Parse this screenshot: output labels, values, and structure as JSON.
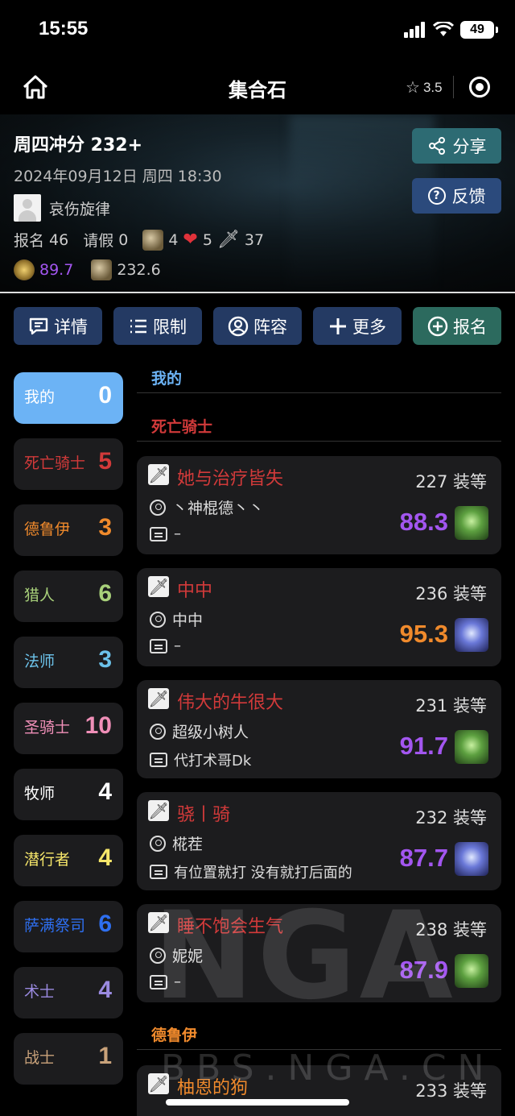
{
  "status_bar": {
    "time": "15:55",
    "battery": "49"
  },
  "nav": {
    "title": "集合石",
    "rating": "3.5"
  },
  "raid": {
    "title": "周四冲分 232+",
    "date": "2024年09月12日 周四 18:30",
    "leader": "哀伤旋律",
    "signup_label": "报名",
    "signup_count": "46",
    "leave_label": "请假",
    "leave_count": "0",
    "tank_count": "4",
    "heal_count": "5",
    "dps_count": "37",
    "score": "89.7",
    "ilvl": "232.6"
  },
  "side_buttons": {
    "share": "分享",
    "feedback": "反馈"
  },
  "actions": [
    {
      "label": "详情",
      "icon": "comment-icon"
    },
    {
      "label": "限制",
      "icon": "list-icon"
    },
    {
      "label": "阵容",
      "icon": "user-circle-icon"
    },
    {
      "label": "更多",
      "icon": "plus-icon"
    },
    {
      "label": "报名",
      "icon": "plus-circle-icon"
    }
  ],
  "classes": [
    {
      "name": "我的",
      "count": "0",
      "color": "#ffffff"
    },
    {
      "name": "死亡骑士",
      "count": "5",
      "color": "#d23a3a"
    },
    {
      "name": "德鲁伊",
      "count": "3",
      "color": "#f08a2c"
    },
    {
      "name": "猎人",
      "count": "6",
      "color": "#a8d07a"
    },
    {
      "name": "法师",
      "count": "3",
      "color": "#6cc2ea"
    },
    {
      "name": "圣骑士",
      "count": "10",
      "color": "#f08fb8"
    },
    {
      "name": "牧师",
      "count": "4",
      "color": "#ffffff"
    },
    {
      "name": "潜行者",
      "count": "4",
      "color": "#f6e66a"
    },
    {
      "name": "萨满祭司",
      "count": "6",
      "color": "#2e6ff0"
    },
    {
      "name": "术士",
      "count": "4",
      "color": "#9a8ae0"
    },
    {
      "name": "战士",
      "count": "1",
      "color": "#c9a27a"
    }
  ],
  "sections": {
    "mine": "我的",
    "death_knight": "死亡骑士",
    "druid": "德鲁伊"
  },
  "ilvl_suffix": "装等",
  "members": [
    {
      "name": "她与治疗皆失",
      "ilvl": "227",
      "user": "丶神棍德丶丶",
      "note": "–",
      "score": "88.3",
      "score_color": "#a356f0",
      "spec_icon": "green-skull-icon"
    },
    {
      "name": "中中",
      "ilvl": "236",
      "user": "中中",
      "note": "–",
      "score": "95.3",
      "score_color": "#f08a2c",
      "spec_icon": "blue-skull-icon"
    },
    {
      "name": "伟大的牛很大",
      "ilvl": "231",
      "user": "超级小树人",
      "note": "代打术哥Dk",
      "score": "91.7",
      "score_color": "#a356f0",
      "spec_icon": "green-skull-icon"
    },
    {
      "name": "骁丨骑",
      "ilvl": "232",
      "user": "椛茬",
      "note": "有位置就打 没有就打后面的",
      "score": "87.7",
      "score_color": "#a356f0",
      "spec_icon": "blue-skull-icon"
    },
    {
      "name": "睡不饱会生气",
      "ilvl": "238",
      "user": "妮妮",
      "note": "–",
      "score": "87.9",
      "score_color": "#a356f0",
      "spec_icon": "green-skull-icon"
    },
    {
      "name": "柚恩的狗",
      "ilvl": "233",
      "user": "",
      "note": "",
      "score": "",
      "score_color": "#a356f0",
      "spec_icon": ""
    }
  ],
  "watermark": {
    "main": "NGA",
    "sub": "BBS.NGA.CN"
  }
}
